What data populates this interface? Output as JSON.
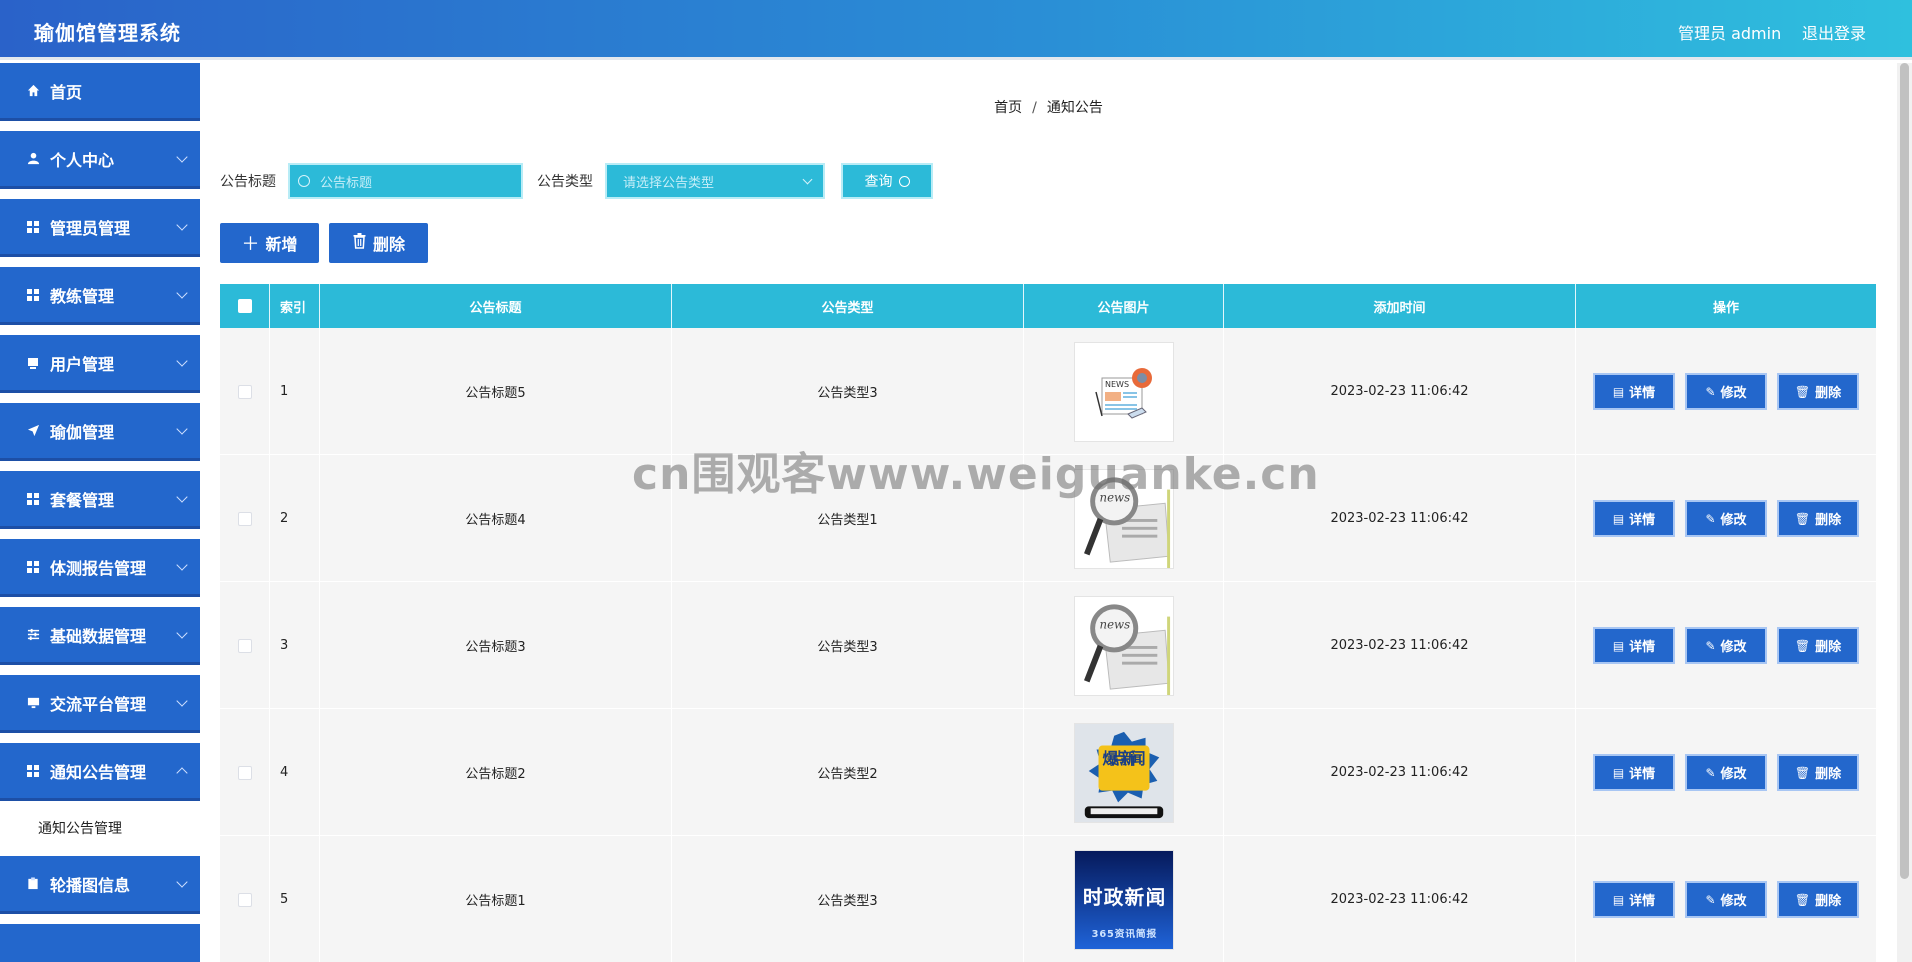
{
  "header": {
    "title": "瑜伽馆管理系统",
    "user": "管理员 admin",
    "logout": "退出登录"
  },
  "sidebar": {
    "items": [
      {
        "label": "首页",
        "icon": "home-icon"
      },
      {
        "label": "个人中心",
        "icon": "person-icon"
      },
      {
        "label": "管理员管理",
        "icon": "grid-icon"
      },
      {
        "label": "教练管理",
        "icon": "grid-icon"
      },
      {
        "label": "用户管理",
        "icon": "card-icon"
      },
      {
        "label": "瑜伽管理",
        "icon": "send-icon"
      },
      {
        "label": "套餐管理",
        "icon": "grid-icon"
      },
      {
        "label": "体测报告管理",
        "icon": "grid-icon"
      },
      {
        "label": "基础数据管理",
        "icon": "sliders-icon"
      },
      {
        "label": "交流平台管理",
        "icon": "monitor-icon"
      },
      {
        "label": "通知公告管理",
        "icon": "grid-icon"
      },
      {
        "label": "轮播图信息",
        "icon": "clipboard-icon"
      }
    ],
    "submenu": "通知公告管理"
  },
  "breadcrumb": {
    "home": "首页",
    "sep": "/",
    "current": "通知公告"
  },
  "search": {
    "title_label": "公告标题",
    "title_placeholder": "公告标题",
    "type_label": "公告类型",
    "type_placeholder": "请选择公告类型",
    "query_label": "查询"
  },
  "actions": {
    "add_label": "新增",
    "delete_label": "删除"
  },
  "table": {
    "columns": [
      "索引",
      "公告标题",
      "公告类型",
      "公告图片",
      "添加时间",
      "操作"
    ],
    "rows": [
      {
        "index": "1",
        "title": "公告标题5",
        "type": "公告类型3",
        "image": "news-illustration",
        "time": "2023-02-23 11:06:42"
      },
      {
        "index": "2",
        "title": "公告标题4",
        "type": "公告类型1",
        "image": "news-magnifier",
        "time": "2023-02-23 11:06:42"
      },
      {
        "index": "3",
        "title": "公告标题3",
        "type": "公告类型3",
        "image": "news-magnifier",
        "time": "2023-02-23 11:06:42"
      },
      {
        "index": "4",
        "title": "公告标题2",
        "type": "公告类型2",
        "image": "hot-news",
        "time": "2023-02-23 11:06:42"
      },
      {
        "index": "5",
        "title": "公告标题1",
        "type": "公告类型3",
        "image": "politics-news",
        "time": "2023-02-23 11:06:42"
      }
    ],
    "op_labels": {
      "detail": "详情",
      "edit": "修改",
      "delete": "删除"
    }
  },
  "images": {
    "hot_news_text": "爆点新闻",
    "politics_news_text": "时政新闻",
    "politics_news_sub": "365资讯简报",
    "news_word": "news",
    "news_word_caps": "NEWS"
  },
  "watermark": "cn围观客www.weiguanke.cn",
  "colors": {
    "primary": "#2367cc",
    "accent": "#2cbad8"
  }
}
